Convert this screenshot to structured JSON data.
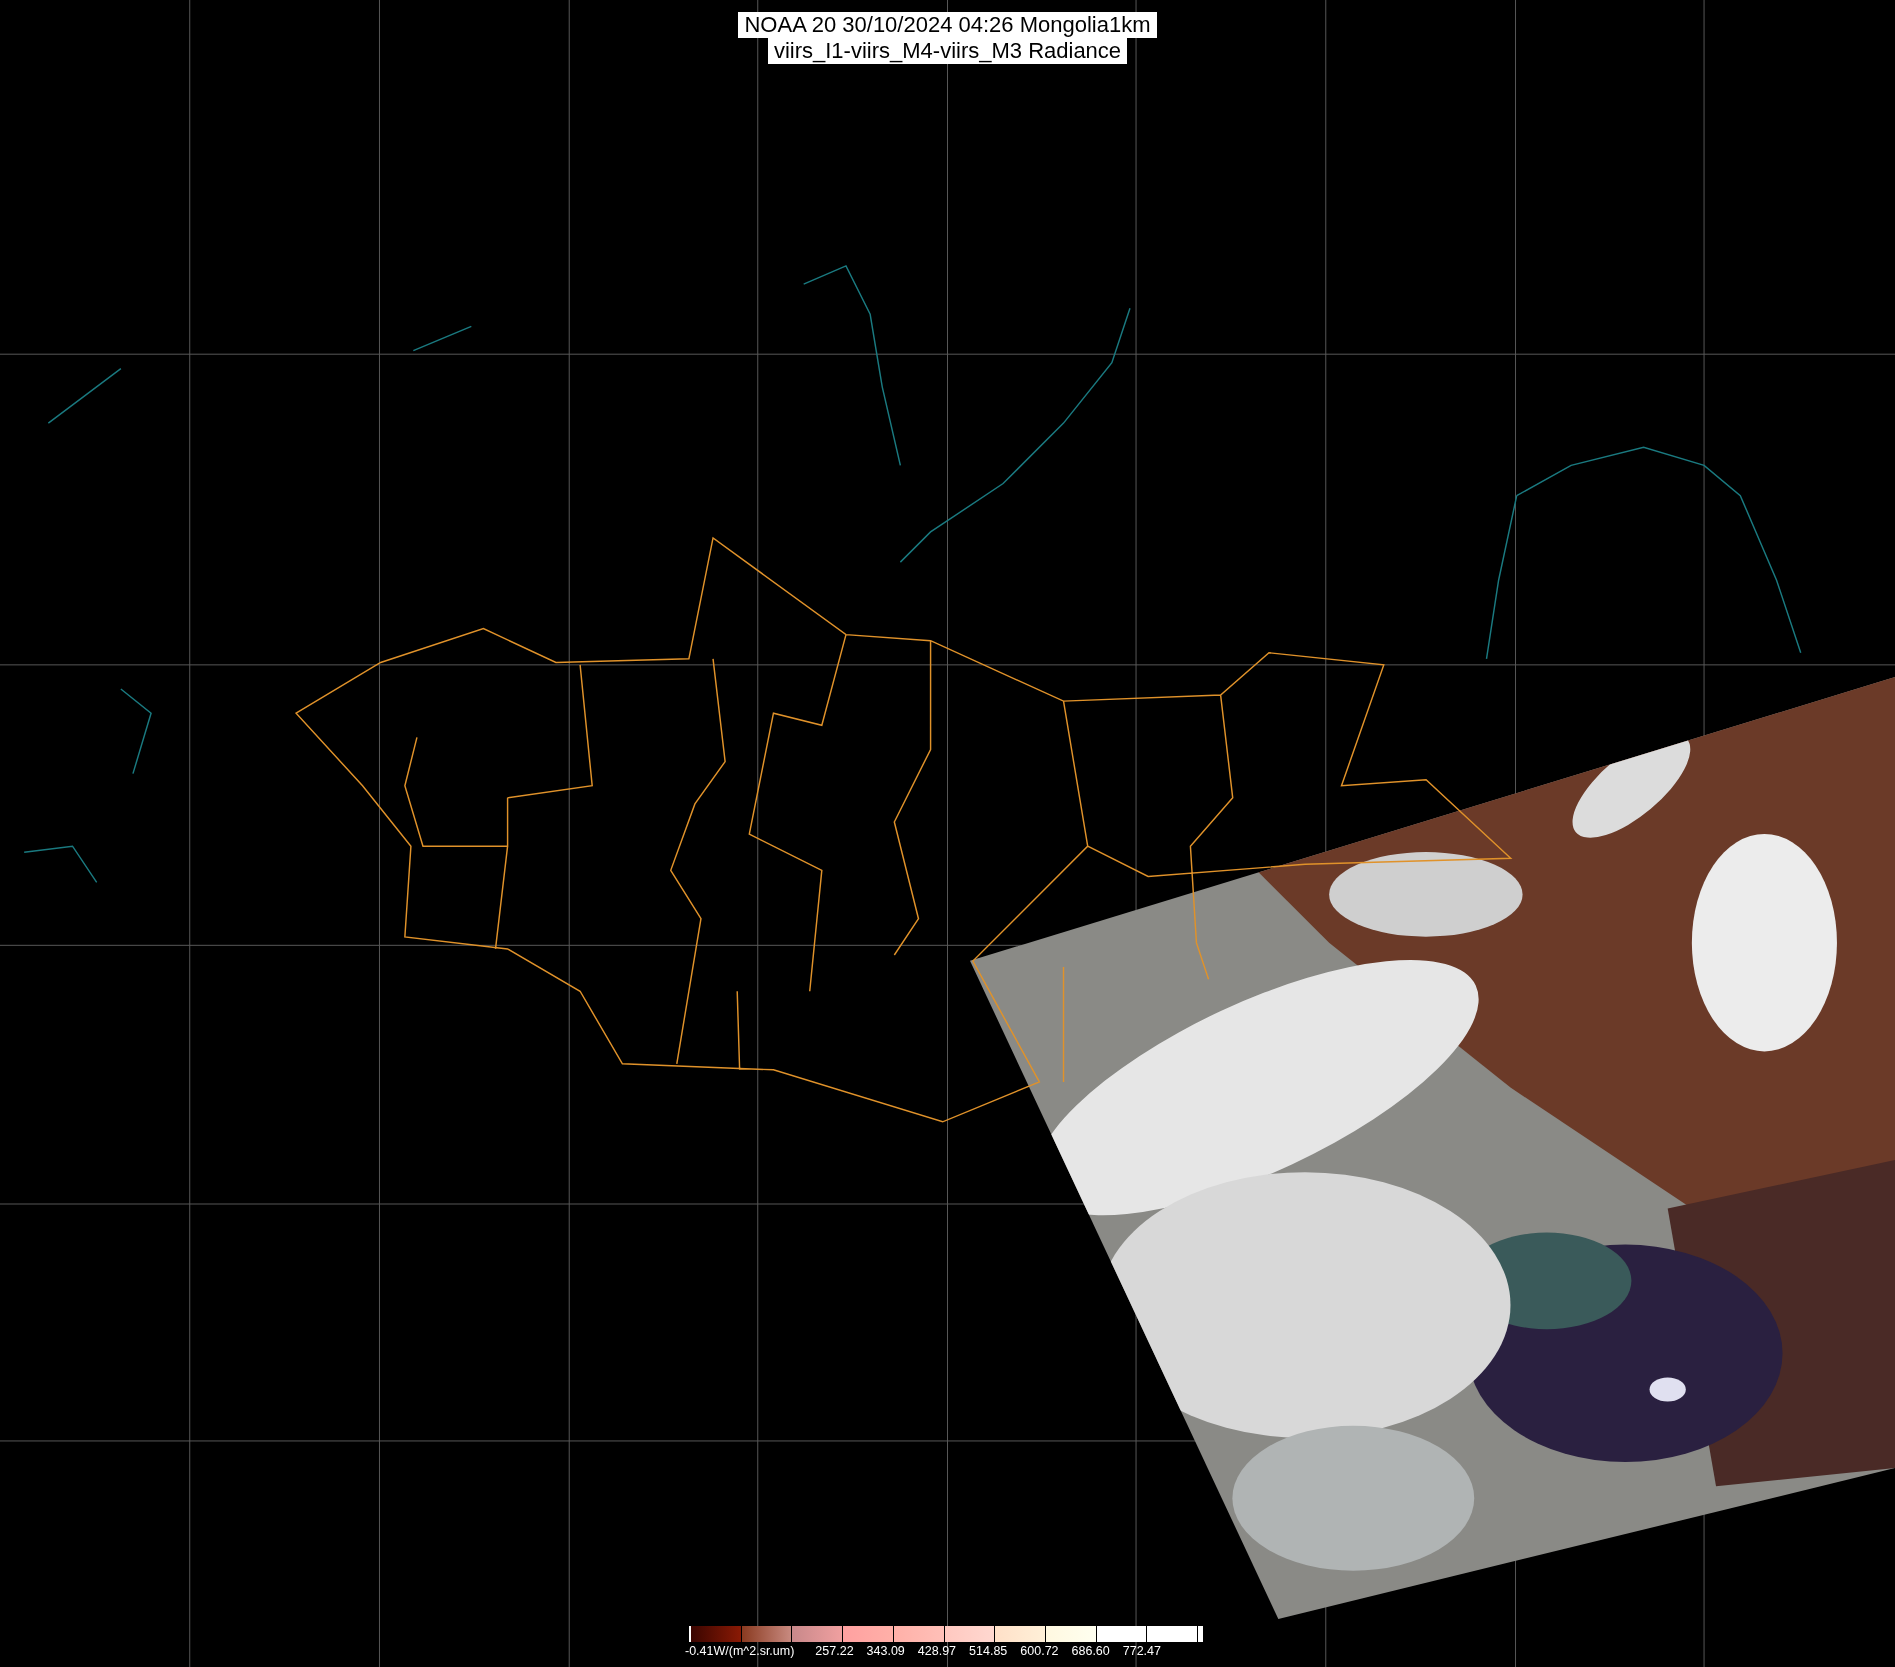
{
  "title": {
    "lines": [
      "NOAA 20 30/10/2024 04:26 Mongolia1km",
      "viirs_I1-viirs_M4-viirs_M3 Radiance"
    ]
  },
  "colorbar": {
    "labels": [
      "-0.41W/(m^2.sr.um)",
      "257.22",
      "343.09",
      "428.97",
      "514.85",
      "600.72",
      "686.60",
      "772.47"
    ]
  }
}
